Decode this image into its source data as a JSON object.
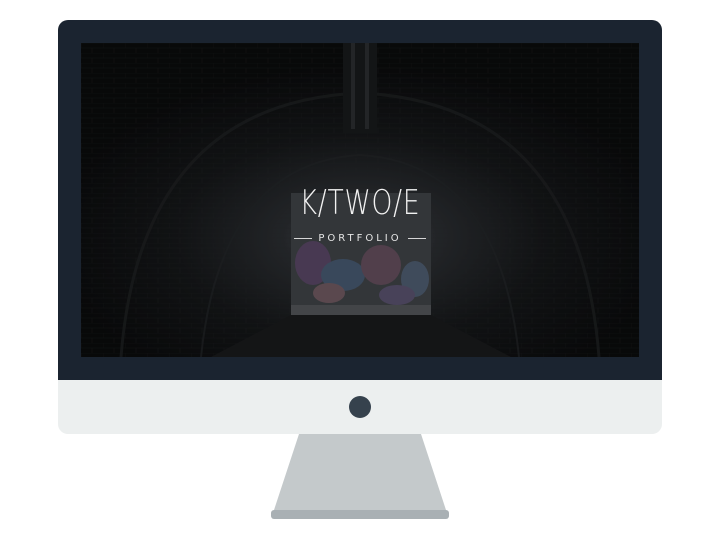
{
  "hero": {
    "title": "K/TWO/E",
    "subtitle": "PORTFOLIO"
  },
  "colors": {
    "bezel": "#1b2430",
    "chin": "#ecefef",
    "power_button": "#36424d",
    "stand": "#c4c9cb",
    "stand_base": "#a9b0b4",
    "hero_text": "#f2f2f2"
  },
  "icons": {
    "power": "power-button-icon"
  }
}
